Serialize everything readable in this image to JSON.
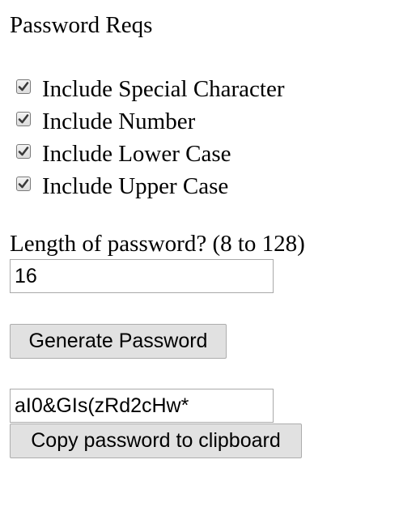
{
  "header": {
    "title": "Password Reqs"
  },
  "options": [
    {
      "label": "Include Special Character",
      "checked": true
    },
    {
      "label": "Include Number",
      "checked": true
    },
    {
      "label": "Include Lower Case",
      "checked": true
    },
    {
      "label": "Include Upper Case",
      "checked": true
    }
  ],
  "length": {
    "label": "Length of password? (8 to 128)",
    "value": "16"
  },
  "generate": {
    "button_label": "Generate Password"
  },
  "output": {
    "password": "aI0&GIs(zRd2cHw*",
    "copy_label": "Copy password to clipboard"
  }
}
